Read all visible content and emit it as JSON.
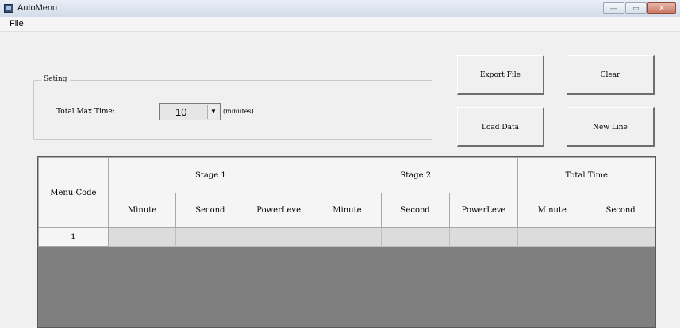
{
  "window": {
    "title": "AutoMenu",
    "controls": {
      "minimize": "—",
      "maximize": "▭",
      "close": "✕"
    }
  },
  "menubar": {
    "items": [
      "File"
    ]
  },
  "setting": {
    "legend": "Seting",
    "max_time_label": "Total Max Time:",
    "max_time_value": "10",
    "unit_label": "(minutes)"
  },
  "buttons": {
    "export": "Export File",
    "clear": "Clear",
    "load": "Load Data",
    "new_line": "New Line"
  },
  "table": {
    "row_header": "Menu Code",
    "groups": [
      "Stage 1",
      "Stage 2",
      "Total Time"
    ],
    "columns": [
      "Minute",
      "Second",
      "PowerLeve",
      "Minute",
      "Second",
      "PowerLeve",
      "Minute",
      "Second"
    ],
    "rows": [
      {
        "code": "1",
        "cells": [
          "",
          "",
          "",
          "",
          "",
          "",
          "",
          ""
        ]
      }
    ]
  },
  "colors": {
    "grid_empty_area": "#7f7f7f",
    "cell_fill": "#dcdcdc",
    "window_bg": "#f0f0f0"
  }
}
